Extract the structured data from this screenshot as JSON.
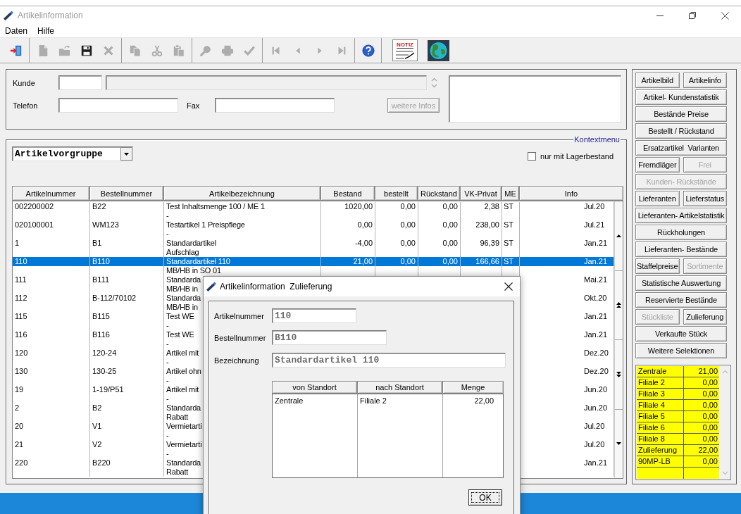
{
  "window": {
    "title": "Artikelinformation",
    "active": false
  },
  "menu": [
    "Daten",
    "Hilfe"
  ],
  "toolbar": [
    {
      "items": [
        {
          "kind": "exit",
          "disabled": false
        }
      ]
    },
    {
      "items": [
        {
          "kind": "new",
          "disabled": true
        },
        {
          "kind": "open",
          "disabled": true
        },
        {
          "kind": "save",
          "disabled": false
        },
        {
          "kind": "delete",
          "disabled": true
        }
      ]
    },
    {
      "items": [
        {
          "kind": "copy",
          "disabled": true
        },
        {
          "kind": "cut",
          "disabled": true
        },
        {
          "kind": "paste",
          "disabled": true
        }
      ]
    },
    {
      "items": [
        {
          "kind": "search",
          "disabled": true
        },
        {
          "kind": "print",
          "disabled": true
        },
        {
          "kind": "confirm",
          "disabled": true
        }
      ]
    },
    {
      "items": [
        {
          "kind": "first",
          "disabled": true
        },
        {
          "kind": "previous",
          "disabled": true
        },
        {
          "kind": "next",
          "disabled": true
        },
        {
          "kind": "last",
          "disabled": true
        }
      ]
    },
    {
      "items": [
        {
          "kind": "help",
          "disabled": false
        }
      ]
    },
    {
      "items": [
        {
          "kind": "note",
          "label": "NOTIZ",
          "disabled": false
        },
        {
          "kind": "globe",
          "disabled": false
        }
      ]
    }
  ],
  "customer": {
    "kunde": {
      "label": "Kunde"
    },
    "name_field": {
      "disabled": true
    },
    "telefon": {
      "label": "Telefon"
    },
    "fax": {
      "label": "Fax"
    },
    "more_button": {
      "label": "weitere Infos",
      "disabled": true
    }
  },
  "filter": {
    "legend": "Kontextmenu",
    "group_select": {
      "value": "Artikelvorgruppe"
    },
    "stock_only": {
      "label": "nur mit Lagerbestand",
      "checked": false
    }
  },
  "table": {
    "columns": [
      "Artikelnummer",
      "Bestellnummer",
      "Artikelbezeichnung",
      "Bestand",
      "bestellt",
      "Rückstand",
      "VK-Privat",
      "ME",
      "Info"
    ],
    "rows": [
      {
        "article_no": "002200002",
        "order_no": "B22",
        "description": "Test Inhaltsmenge 100 / ME 1",
        "description_2": "-",
        "stock": "1020,00",
        "ordered": "0,00",
        "backlog": "0,00",
        "price": "2,38",
        "unit": "ST",
        "info": "Jul.20",
        "selected": false
      },
      {
        "article_no": "020100001",
        "order_no": "WM123",
        "description": "Testartikel 1 Preispflege",
        "description_2": "-",
        "stock": "0,00",
        "ordered": "0,00",
        "backlog": "0,00",
        "price": "238,00",
        "unit": "ST",
        "info": "Jul.21",
        "selected": false
      },
      {
        "article_no": "1",
        "order_no": "B1",
        "description": "Standardartikel",
        "description_2": "Aufschlag",
        "stock": "-4,00",
        "ordered": "0,00",
        "backlog": "0,00",
        "price": "96,39",
        "unit": "ST",
        "info": "Jan.21",
        "selected": false
      },
      {
        "article_no": "110",
        "order_no": "B110",
        "description": "Standardartikel 110",
        "description_2": "MB/HB in SO 01",
        "stock": "21,00",
        "ordered": "0,00",
        "backlog": "0,00",
        "price": "166,66",
        "unit": "ST",
        "info": "Jan.21",
        "selected": true
      },
      {
        "article_no": "111",
        "order_no": "B111",
        "description": "Standarda",
        "description_2": "MB/HB in",
        "info": "Mai.21",
        "selected": false
      },
      {
        "article_no": "112",
        "order_no": "B-112/70102",
        "description": "Standarda",
        "description_2": "MB/HB in",
        "info": "Okt.20",
        "selected": false
      },
      {
        "article_no": "115",
        "order_no": "B115",
        "description": "Test WE",
        "description_2": "-",
        "info": "Jan.21",
        "selected": false
      },
      {
        "article_no": "116",
        "order_no": "B116",
        "description": "Test WE",
        "description_2": "-",
        "info": "Jan.21",
        "selected": false
      },
      {
        "article_no": "120",
        "order_no": "120-24",
        "description": "Artikel mit",
        "description_2": "-",
        "info": "Dez.20",
        "selected": false
      },
      {
        "article_no": "130",
        "order_no": "130-25",
        "description": "Artikel ohn",
        "description_2": "-",
        "info": "Dez.20",
        "selected": false
      },
      {
        "article_no": "19",
        "order_no": "1-19/P51",
        "description": "Artikel mit",
        "description_2": "-",
        "info": "Jun.20",
        "selected": false
      },
      {
        "article_no": "2",
        "order_no": "B2",
        "description": "Standarda",
        "description_2": "Rabatt",
        "info": "Jun.20",
        "selected": false
      },
      {
        "article_no": "20",
        "order_no": "V1",
        "description": "Vermietarti",
        "description_2": "-",
        "info": "Jul.20",
        "selected": false
      },
      {
        "article_no": "21",
        "order_no": "V2",
        "description": "Vermietarti",
        "description_2": "-",
        "info": "Jul.20",
        "selected": false
      },
      {
        "article_no": "220",
        "order_no": "B220",
        "description": "Standarda",
        "description_2": "Rabatt",
        "info": "Jan.21",
        "selected": false
      }
    ]
  },
  "side_buttons": [
    {
      "buttons": [
        {
          "label": "Artikelbild",
          "disabled": false
        },
        {
          "label": "Artikelinfo",
          "disabled": false
        }
      ]
    },
    {
      "buttons": [
        {
          "label": "Artikel- Kundenstatistik",
          "disabled": false
        }
      ]
    },
    {
      "buttons": [
        {
          "label": "Bestände Preise",
          "disabled": false
        }
      ]
    },
    {
      "buttons": [
        {
          "label": "Bestellt / Rückstand",
          "disabled": false
        }
      ]
    },
    {
      "buttons": [
        {
          "label": "Ersatzartikel  Varianten",
          "disabled": false
        }
      ]
    },
    {
      "buttons": [
        {
          "label": "Fremdläger",
          "disabled": false
        },
        {
          "label": "Frei",
          "disabled": true
        }
      ]
    },
    {
      "buttons": [
        {
          "label": "Kunden- Rückstände",
          "disabled": true
        }
      ]
    },
    {
      "buttons": [
        {
          "label": "Lieferanten",
          "disabled": false
        },
        {
          "label": "Lieferstatus",
          "disabled": false
        }
      ]
    },
    {
      "buttons": [
        {
          "label": "Lieferanten- Artikelstatistik",
          "disabled": false
        }
      ]
    },
    {
      "buttons": [
        {
          "label": "Rückholungen",
          "disabled": false
        }
      ]
    },
    {
      "buttons": [
        {
          "label": "Lieferanten- Bestände",
          "disabled": false
        }
      ]
    },
    {
      "buttons": [
        {
          "label": "Staffelpreise",
          "disabled": false
        },
        {
          "label": "Sortimente",
          "disabled": true
        }
      ]
    },
    {
      "buttons": [
        {
          "label": "Statistische Auswertung",
          "disabled": false
        }
      ]
    },
    {
      "buttons": [
        {
          "label": "Reservierte Bestände",
          "disabled": false
        }
      ]
    },
    {
      "buttons": [
        {
          "label": "Stückliste",
          "disabled": true
        },
        {
          "label": "Zulieferung",
          "disabled": false
        }
      ]
    },
    {
      "buttons": [
        {
          "label": "Verkaufte Stück",
          "disabled": false
        }
      ]
    },
    {
      "buttons": [
        {
          "label": "Weitere Selektionen",
          "disabled": false
        }
      ]
    }
  ],
  "stock": [
    {
      "location": "Zentrale",
      "quantity": "21,00"
    },
    {
      "location": "Filiale 2",
      "quantity": "0,00"
    },
    {
      "location": "Filiale 3",
      "quantity": "0,00"
    },
    {
      "location": "Filiale 4",
      "quantity": "0,00"
    },
    {
      "location": "Filiale 5",
      "quantity": "0,00"
    },
    {
      "location": "Filiale 6",
      "quantity": "0,00"
    },
    {
      "location": "Filiale 8",
      "quantity": "0,00"
    },
    {
      "location": "Zulieferung",
      "quantity": "22,00"
    },
    {
      "location": "90MP-LB",
      "quantity": "0,00"
    }
  ],
  "dialog": {
    "title": "Artikelinformation  Zulieferung",
    "fields": [
      {
        "label": "Artikelnummer",
        "value": "110",
        "readonly": true
      },
      {
        "label": "Bestellnummer",
        "value": "B110",
        "readonly": true
      },
      {
        "label": "Bezeichnung",
        "value": "Standardartikel 110",
        "readonly": true
      }
    ],
    "table": {
      "columns": [
        "von Standort",
        "nach Standort",
        "Menge"
      ],
      "rows": [
        [
          "Zentrale",
          "Filiale 2",
          "22,00"
        ]
      ]
    },
    "ok_button": {
      "label": "OK",
      "focused": true
    }
  }
}
